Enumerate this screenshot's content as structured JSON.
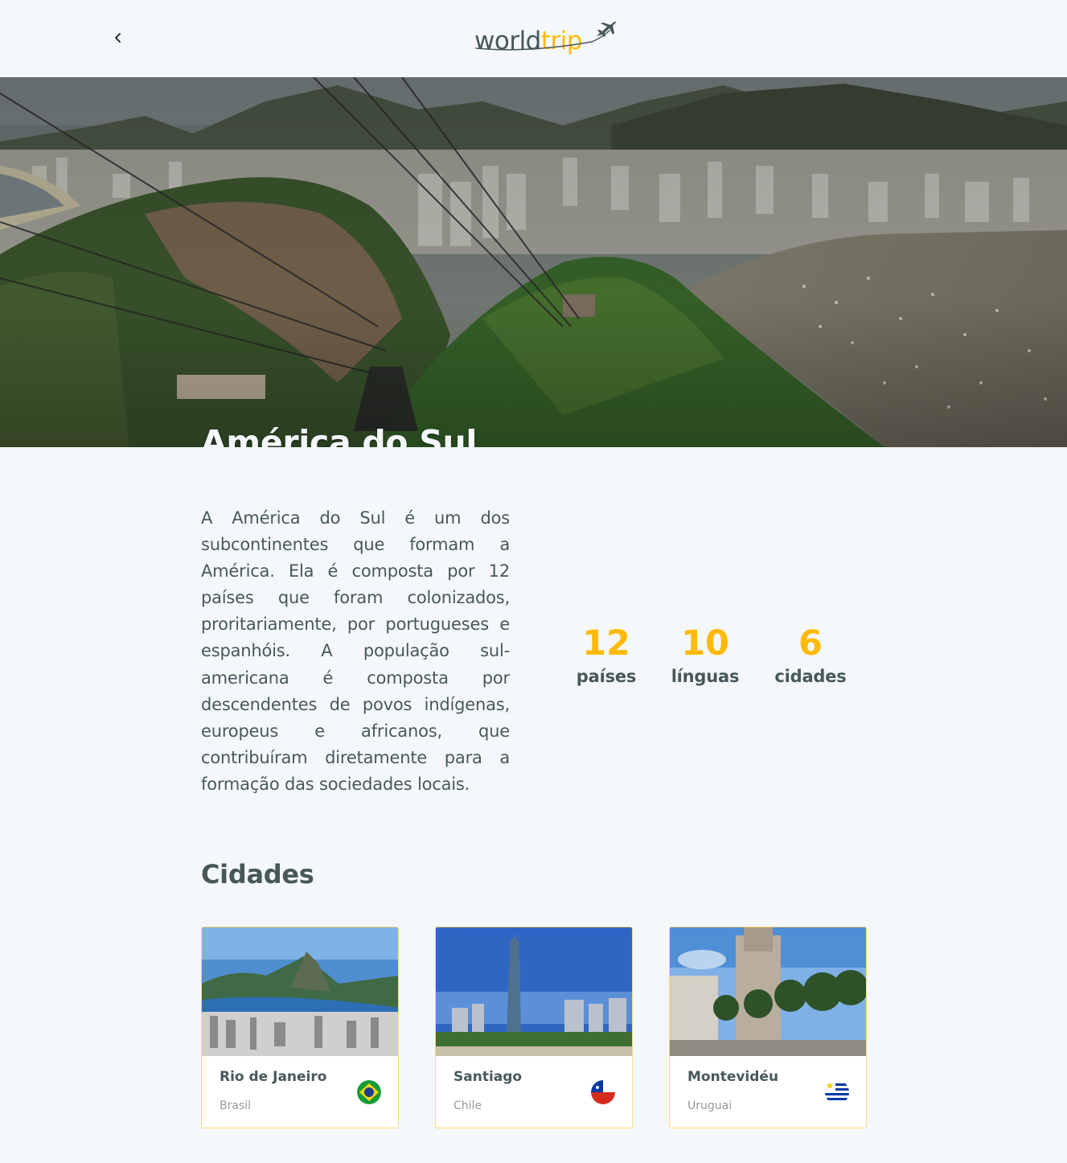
{
  "header": {
    "back_icon": "chevron-left-icon",
    "logo_part1": "world",
    "logo_part2": "trip",
    "logo_icon": "airplane-icon"
  },
  "hero": {
    "title": "América do Sul"
  },
  "description": "A América do Sul é um dos subcontinentes que formam a América. Ela é composta por 12 países que foram colonizados, proritariamente, por portugueses e espanhóis. A população sul-americana é composta por descendentes de povos indígenas, europeus e africanos, que contribuíram diretamente para a formação das sociedades locais.",
  "stats": [
    {
      "number": "12",
      "label": "países"
    },
    {
      "number": "10",
      "label": "línguas"
    },
    {
      "number": "6",
      "label": "cidades"
    }
  ],
  "cities": {
    "title": "Cidades",
    "items": [
      {
        "name": "Rio de Janeiro",
        "country": "Brasil",
        "flag_icon": "brazil-flag-icon"
      },
      {
        "name": "Santiago",
        "country": "Chile",
        "flag_icon": "chile-flag-icon"
      },
      {
        "name": "Montevidéu",
        "country": "Uruguai",
        "flag_icon": "uruguay-flag-icon"
      }
    ]
  },
  "colors": {
    "accent": "#ffba08",
    "text": "#47585b",
    "background": "#f5f8fa",
    "muted": "#999999"
  }
}
